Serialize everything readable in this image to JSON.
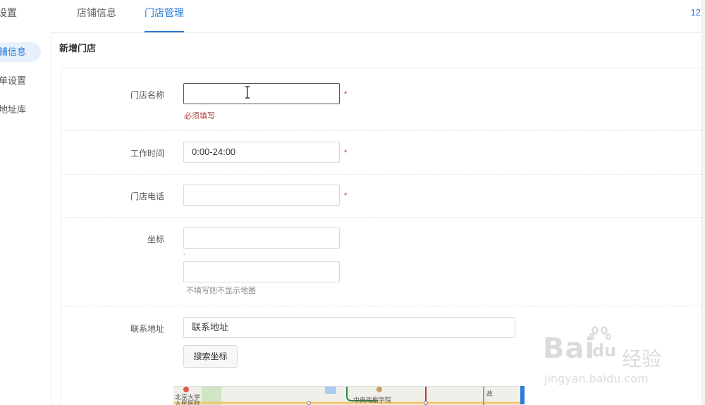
{
  "sidebar": {
    "title": "设置",
    "items": [
      {
        "label": "铺信息",
        "active": true
      },
      {
        "label": "单设置",
        "active": false
      },
      {
        "label": "地址库",
        "active": false
      }
    ]
  },
  "tabs": [
    {
      "label": "店铺信息",
      "active": false
    },
    {
      "label": "门店管理",
      "active": true
    }
  ],
  "top_right_text": "12",
  "section_title": "新增门店",
  "form": {
    "store_name": {
      "label": "门店名称",
      "value": "",
      "required": "*",
      "error": "必须填写"
    },
    "work_time": {
      "label": "工作时间",
      "value": "0:00-24:00",
      "required": "*"
    },
    "phone": {
      "label": "门店电话",
      "value": "",
      "required": "*"
    },
    "coords": {
      "label": "坐标",
      "value1": "",
      "separator": "-",
      "value2": "",
      "hint": "不填写则不显示地图"
    },
    "address": {
      "label": "联系地址",
      "value": "联系地址",
      "search_button": "搜索坐标"
    }
  },
  "map": {
    "labels": [
      "北京大学",
      "人民医院",
      "中央戏剧学院",
      "故"
    ]
  },
  "watermark": {
    "brand": "Bai",
    "brand2": "du",
    "cn": "经验",
    "url": "jingyan.baidu.com"
  },
  "colors": {
    "accent": "#2b7bd9",
    "error": "#a94442"
  }
}
